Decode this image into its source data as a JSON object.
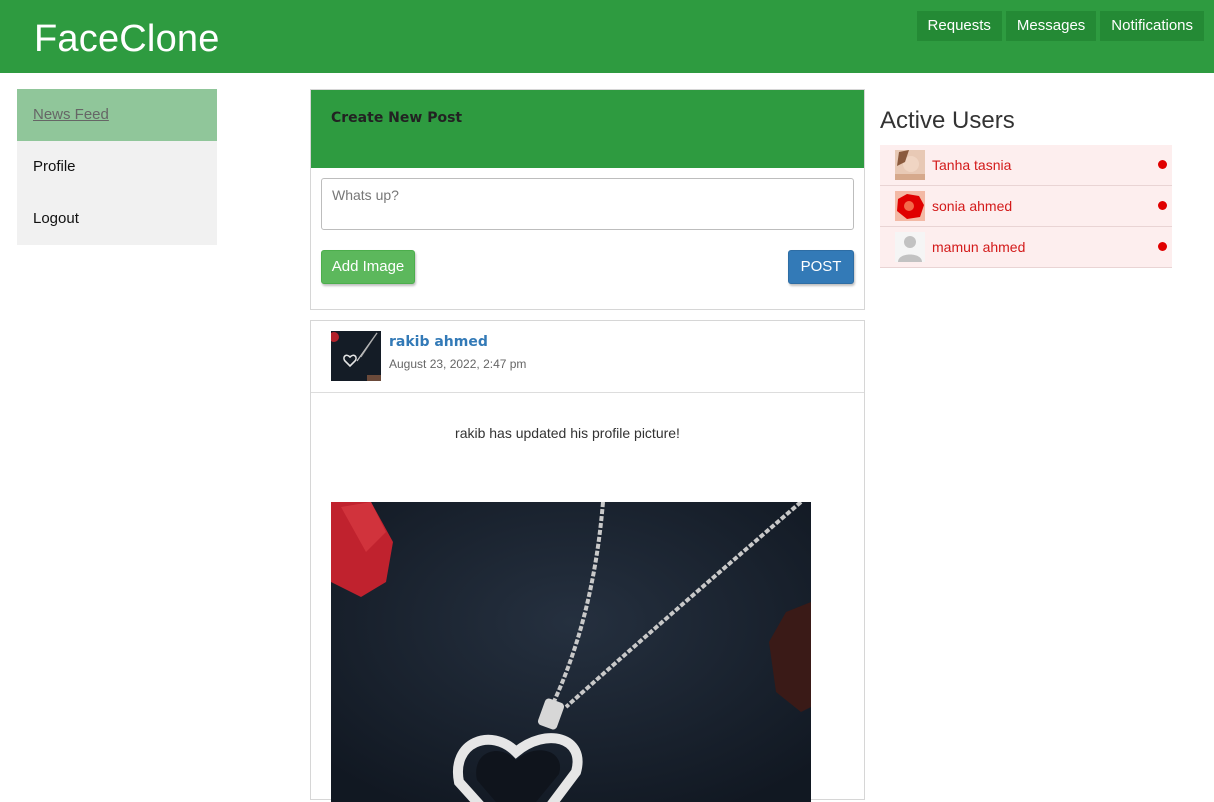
{
  "header": {
    "brand": "FaceClone",
    "nav": [
      "Requests",
      "Messages",
      "Notifications"
    ]
  },
  "sidebar": {
    "items": [
      {
        "label": "News Feed",
        "active": true
      },
      {
        "label": "Profile",
        "active": false
      },
      {
        "label": "Logout",
        "active": false
      }
    ]
  },
  "create_post": {
    "title": "Create New Post",
    "placeholder": "Whats up?",
    "add_image_label": "Add Image",
    "post_label": "POST"
  },
  "post": {
    "author": "rakib ahmed",
    "date": "August 23, 2022, 2:47 pm",
    "text": "rakib has updated his profile picture!"
  },
  "active_users": {
    "title": "Active Users",
    "users": [
      {
        "name": "Tanha tasnia",
        "online": true
      },
      {
        "name": "sonia ahmed",
        "online": true
      },
      {
        "name": "mamun ahmed",
        "online": true
      }
    ]
  },
  "colors": {
    "brand_green": "#2e9b40",
    "nav_button": "#248a35",
    "sidebar_active": "#90c69a",
    "add_image": "#5cb85c",
    "post_button": "#337ab7",
    "author_link": "#337ab7",
    "user_row_bg": "#fdeeee",
    "user_name": "#d31a1a",
    "online_dot": "#e00000"
  }
}
